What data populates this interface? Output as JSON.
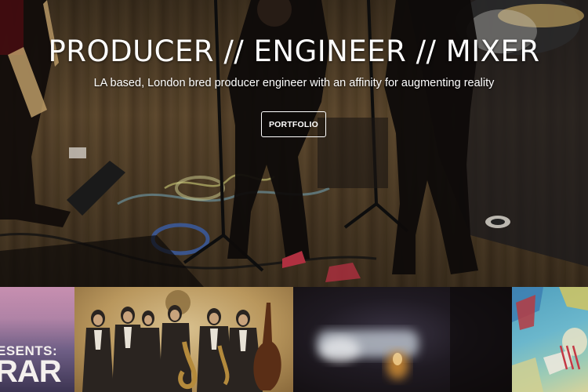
{
  "hero": {
    "title": "PRODUCER // ENGINEER // MIXER",
    "subtitle": "LA based, London bred producer engineer with an affinity for augmenting reality",
    "cta_label": "PORTFOLIO"
  },
  "thumbnails": [
    {
      "name": "thumb-presents",
      "line1": "ESENTS:",
      "line2": "RAR"
    },
    {
      "name": "thumb-band-photo"
    },
    {
      "name": "thumb-blurred-performance"
    },
    {
      "name": "thumb-illustrated-cover"
    }
  ],
  "colors": {
    "text": "#ffffff",
    "button_border": "#ffffff",
    "floor": "#6e5636"
  }
}
